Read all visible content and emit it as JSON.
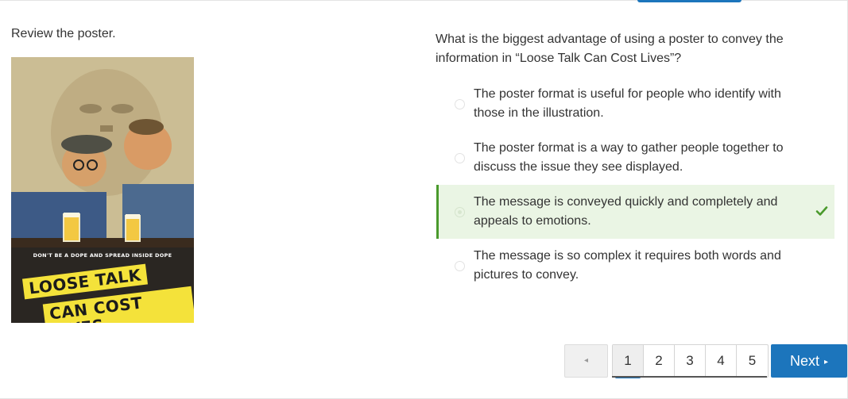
{
  "prompt": "Review the poster.",
  "poster": {
    "tagline": "DON'T BE A DOPE AND SPREAD INSIDE DOPE",
    "line1": "LOOSE TALK",
    "line2": "CAN COST LIVES",
    "colors": {
      "banner": "#f4e23a",
      "background": "#c9b98f"
    }
  },
  "question": "What is the biggest advantage of using a poster to convey the information in “Loose Talk Can Cost Lives”?",
  "options": [
    {
      "text": "The poster format is useful for people who identify with those in the illustration.",
      "selected": false
    },
    {
      "text": "The poster format is a way to gather people together to discuss the issue they see displayed.",
      "selected": false
    },
    {
      "text": "The message is conveyed quickly and completely and appeals to emotions.",
      "selected": true,
      "correct": true
    },
    {
      "text": "The message is so complex it requires both words and pictures to convey.",
      "selected": false
    }
  ],
  "pagination": {
    "prev_icon": "◂",
    "pages": [
      "1",
      "2",
      "3",
      "4",
      "5"
    ],
    "current": "1",
    "next_label": "Next",
    "next_icon": "▸"
  },
  "colors": {
    "accent": "#1c75bc",
    "correct": "#4a9a2c",
    "selected_bg": "#eaf5e4"
  }
}
